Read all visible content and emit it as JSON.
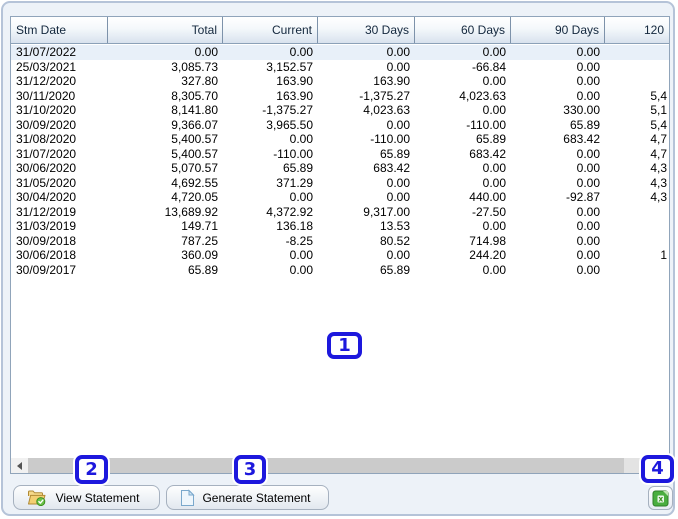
{
  "colors": {
    "badge_blue": "#1d18dd",
    "selected_row": "#e8f0f9",
    "header_bottom": "#d8e2ee",
    "excel_green": "#4aae3f",
    "folder_yellow": "#f3cf72"
  },
  "table": {
    "columns": [
      {
        "label": "Stm Date",
        "align": "left"
      },
      {
        "label": "Total",
        "align": "right"
      },
      {
        "label": "Current",
        "align": "right"
      },
      {
        "label": "30 Days",
        "align": "right"
      },
      {
        "label": "60 Days",
        "align": "right"
      },
      {
        "label": "90 Days",
        "align": "right"
      },
      {
        "label": "120",
        "align": "right",
        "note": "truncated at viewport edge"
      }
    ],
    "rows": [
      [
        "31/07/2022",
        "0.00",
        "0.00",
        "0.00",
        "0.00",
        "0.00",
        ""
      ],
      [
        "25/03/2021",
        "3,085.73",
        "3,152.57",
        "0.00",
        "-66.84",
        "0.00",
        ""
      ],
      [
        "31/12/2020",
        "327.80",
        "163.90",
        "163.90",
        "0.00",
        "0.00",
        ""
      ],
      [
        "30/11/2020",
        "8,305.70",
        "163.90",
        "-1,375.27",
        "4,023.63",
        "0.00",
        "5,4"
      ],
      [
        "31/10/2020",
        "8,141.80",
        "-1,375.27",
        "4,023.63",
        "0.00",
        "330.00",
        "5,1"
      ],
      [
        "30/09/2020",
        "9,366.07",
        "3,965.50",
        "0.00",
        "-110.00",
        "65.89",
        "5,4"
      ],
      [
        "31/08/2020",
        "5,400.57",
        "0.00",
        "-110.00",
        "65.89",
        "683.42",
        "4,7"
      ],
      [
        "31/07/2020",
        "5,400.57",
        "-110.00",
        "65.89",
        "683.42",
        "0.00",
        "4,7"
      ],
      [
        "30/06/2020",
        "5,070.57",
        "65.89",
        "683.42",
        "0.00",
        "0.00",
        "4,3"
      ],
      [
        "31/05/2020",
        "4,692.55",
        "371.29",
        "0.00",
        "0.00",
        "0.00",
        "4,3"
      ],
      [
        "30/04/2020",
        "4,720.05",
        "0.00",
        "0.00",
        "440.00",
        "-92.87",
        "4,3"
      ],
      [
        "31/12/2019",
        "13,689.92",
        "4,372.92",
        "9,317.00",
        "-27.50",
        "0.00",
        ""
      ],
      [
        "31/03/2019",
        "149.71",
        "136.18",
        "13.53",
        "0.00",
        "0.00",
        ""
      ],
      [
        "30/09/2018",
        "787.25",
        "-8.25",
        "80.52",
        "714.98",
        "0.00",
        ""
      ],
      [
        "30/06/2018",
        "360.09",
        "0.00",
        "0.00",
        "244.20",
        "0.00",
        "1"
      ],
      [
        "30/09/2017",
        "65.89",
        "0.00",
        "65.89",
        "0.00",
        "0.00",
        ""
      ]
    ],
    "selected_row_index": 0
  },
  "buttons": {
    "view": {
      "label": "View Statement",
      "icon": "open-folder-check-icon"
    },
    "generate": {
      "label": "Generate Statement",
      "icon": "document-icon"
    },
    "export_excel": {
      "icon": "excel-export-icon"
    }
  },
  "badges": [
    {
      "label": "1"
    },
    {
      "label": "2"
    },
    {
      "label": "3"
    },
    {
      "label": "4"
    }
  ]
}
